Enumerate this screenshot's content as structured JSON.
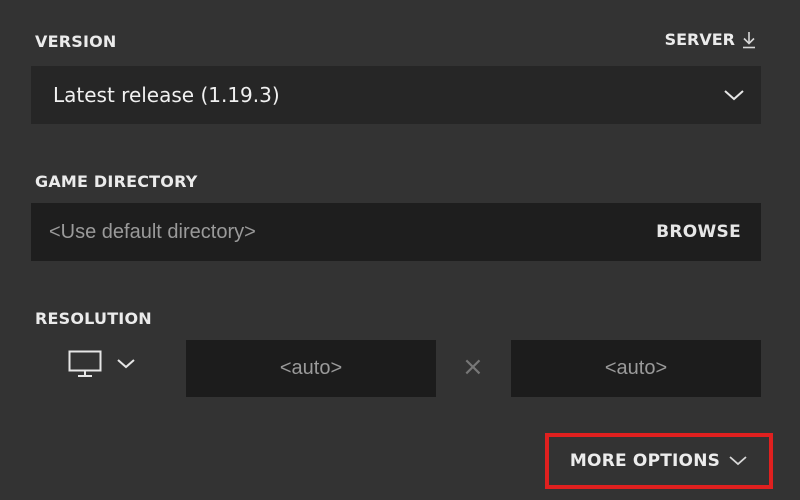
{
  "version": {
    "label": "VERSION",
    "server_link": "SERVER",
    "server_icon": "download-arrow-icon",
    "selected": "Latest release (1.19.3)",
    "dropdown_icon": "chevron-down-icon"
  },
  "game_directory": {
    "label": "GAME DIRECTORY",
    "placeholder": "<Use default directory>",
    "value": "",
    "browse_label": "BROWSE"
  },
  "resolution": {
    "label": "RESOLUTION",
    "monitor_icon": "monitor-icon",
    "dropdown_icon": "chevron-down-icon",
    "width_placeholder": "<auto>",
    "height_placeholder": "<auto>",
    "separator": "×"
  },
  "more_options": {
    "label": "MORE OPTIONS",
    "icon": "chevron-down-icon",
    "highlight_color": "#e0201f"
  },
  "colors": {
    "background": "#333333",
    "field_background": "#1e1e1e",
    "text": "#ebebeb",
    "placeholder": "#9a9a9a"
  }
}
